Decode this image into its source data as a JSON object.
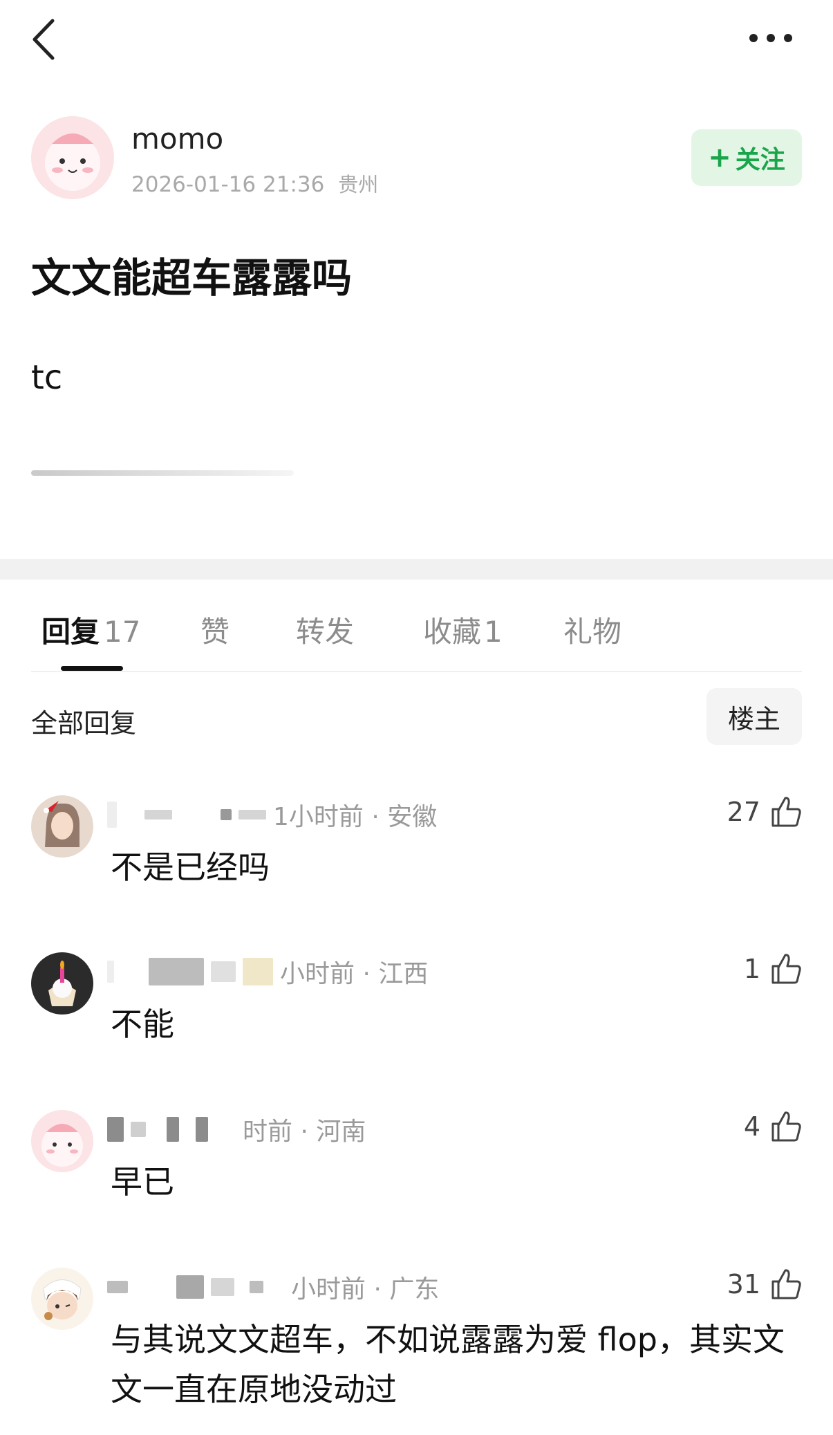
{
  "post": {
    "author": "momo",
    "datetime": "2026-01-16 21:36",
    "location": "贵州",
    "follow_plus": "+",
    "follow_label": "关注",
    "title": "文文能超车露露吗",
    "body": "tc"
  },
  "tabs": [
    {
      "label": "回复",
      "count": "17"
    },
    {
      "label": "赞",
      "count": ""
    },
    {
      "label": "转发",
      "count": ""
    },
    {
      "label": "收藏",
      "count": "1"
    },
    {
      "label": "礼物",
      "count": ""
    }
  ],
  "replies_header": "全部回复",
  "op_filter": "楼主",
  "comments": [
    {
      "meta": "1小时前 · 安徽",
      "text": "不是已经吗",
      "likes": "27"
    },
    {
      "meta": "小时前 · 江西",
      "text": "不能",
      "likes": "1"
    },
    {
      "meta": "时前 · 河南",
      "text": "早已",
      "likes": "4"
    },
    {
      "meta": "小时前 · 广东",
      "text": "与其说文文超车，不如说露露为爱 flop，其实文文一直在原地没动过",
      "likes": "31"
    }
  ],
  "colors": {
    "follow_text": "#1aa54a",
    "follow_bg": "#e3f6e6",
    "meta": "#a9a9a9"
  },
  "icons": [
    "back-arrow-icon",
    "more-icon",
    "thumbs-up-icon"
  ]
}
